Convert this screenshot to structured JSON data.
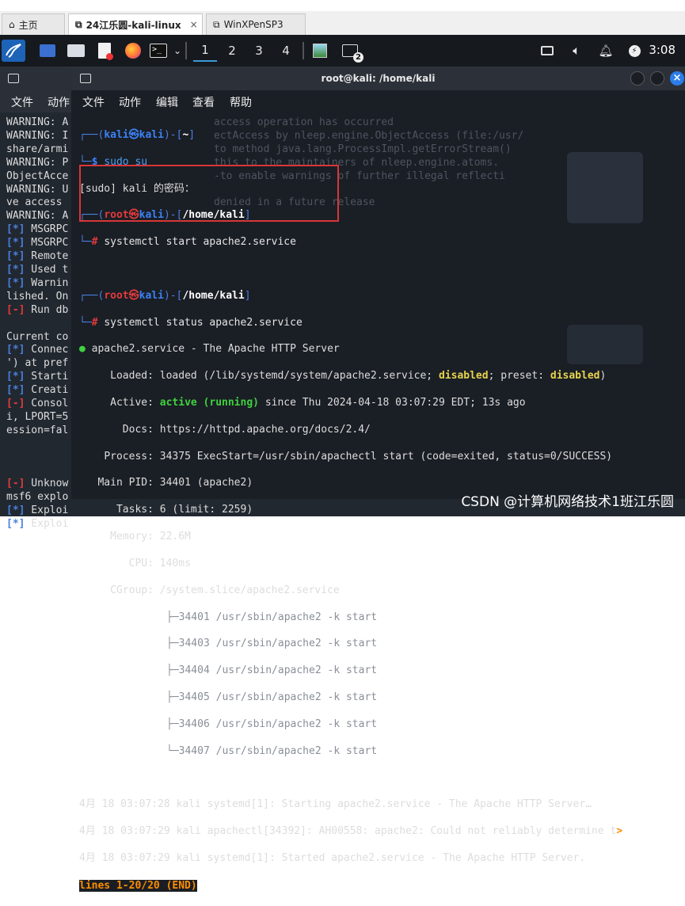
{
  "browser_tabs": [
    {
      "label": "主页",
      "icon": "home-icon",
      "active": false
    },
    {
      "label": "24江乐圆-kali-linux",
      "icon": "vm-icon",
      "active": true
    },
    {
      "label": "WinXPenSP3",
      "icon": "vm-icon",
      "active": false
    }
  ],
  "panel": {
    "workspaces": [
      "1",
      "2",
      "3",
      "4"
    ],
    "current_workspace": "1",
    "task_badge": "2",
    "clock": "3:08"
  },
  "back_window": {
    "menu": [
      "文件",
      "动作"
    ],
    "lines": [
      "WARNING: A",
      "WARNING: I",
      "share/armi",
      "WARNING: P",
      "ObjectAcce",
      "WARNING: U",
      "ve access",
      "WARNING: A",
      "[*] MSGRPC",
      "[*] MSGRPC",
      "[*] Remote",
      "[*] Used t",
      "[*] Warnin",
      "lished. On",
      "[-] Run db",
      "",
      "Current co",
      "[*] Connec",
      "') at pref",
      "[*] Starti",
      "[*] Creati",
      "[-] Consol",
      "i, LPORT=5",
      "ession=fal",
      "",
      "",
      "",
      "[-] Unknow",
      "msf6 explo",
      "[*] Exploi",
      "[*] Exploi"
    ]
  },
  "terminal": {
    "title": "root@kali: /home/kali",
    "menu": [
      "文件",
      "动作",
      "编辑",
      "查看",
      "帮助"
    ],
    "prompt_user": "kali",
    "prompt_host": "kali",
    "prompt_dir1": "~",
    "cmd1": "sudo su",
    "sudo_prompt": "[sudo] kali 的密码：",
    "root_user": "root",
    "root_dir": "/home/kali",
    "cmd2": "systemctl start apache2.service",
    "cmd3": "systemctl status apache2.service",
    "svc_header": "apache2.service - The Apache HTTP Server",
    "loaded_label": "Loaded:",
    "loaded_value_pre": "loaded (/lib/systemd/system/apache2.service; ",
    "loaded_disabled1": "disabled",
    "loaded_value_mid": "; preset: ",
    "loaded_disabled2": "disabled",
    "loaded_value_post": ")",
    "active_label": "Active:",
    "active_value": "active (running)",
    "active_rest": " since Thu 2024-04-18 03:07:29 EDT; 13s ago",
    "docs_label": "Docs:",
    "docs_value": "https://httpd.apache.org/docs/2.4/",
    "process_label": "Process:",
    "process_value": "34375 ExecStart=/usr/sbin/apachectl start (code=exited, status=0/SUCCESS)",
    "mainpid_label": "Main PID:",
    "mainpid_value": "34401 (apache2)",
    "tasks_label": "Tasks:",
    "tasks_value": "6 (limit: 2259)",
    "memory_label": "Memory:",
    "memory_value": "22.6M",
    "cpu_label": "CPU:",
    "cpu_value": "140ms",
    "cgroup_label": "CGroup:",
    "cgroup_value": "/system.slice/apache2.service",
    "cgroup_children": [
      "├─34401 /usr/sbin/apache2 -k start",
      "├─34403 /usr/sbin/apache2 -k start",
      "├─34404 /usr/sbin/apache2 -k start",
      "├─34405 /usr/sbin/apache2 -k start",
      "├─34406 /usr/sbin/apache2 -k start",
      "└─34407 /usr/sbin/apache2 -k start"
    ],
    "logs": [
      "4月 18 03:07:28 kali systemd[1]: Starting apache2.service - The Apache HTTP Server…",
      "4月 18 03:07:29 kali apachectl[34392]: AH00558: apache2: Could not reliably determine t",
      "4月 18 03:07:29 kali systemd[1]: Started apache2.service - The Apache HTTP Server."
    ],
    "log2_overflow": ">",
    "pager_status": "lines 1-20/20 (END)"
  },
  "ghost_lines": [
    "access operation has occurred",
    "ectAccess by nleep.engine.ObjectAccess (file:/usr/",
    "to method java.lang.ProcessImpl.getErrorStream()",
    "this to the maintainers of nleep.engine.atoms.",
    "-to enable warnings of further illegal reflecti",
    "",
    "denied in a future release"
  ],
  "watermark": "CSDN @计算机网络技术1班江乐圆",
  "colors": {
    "accent": "#3a9bd9",
    "prompt_blue": "#3b82f6",
    "root_red": "#e23b3b",
    "active_green": "#3fd13f",
    "disabled_yellow": "#e8d44d",
    "pager_orange": "#ff8c00"
  }
}
